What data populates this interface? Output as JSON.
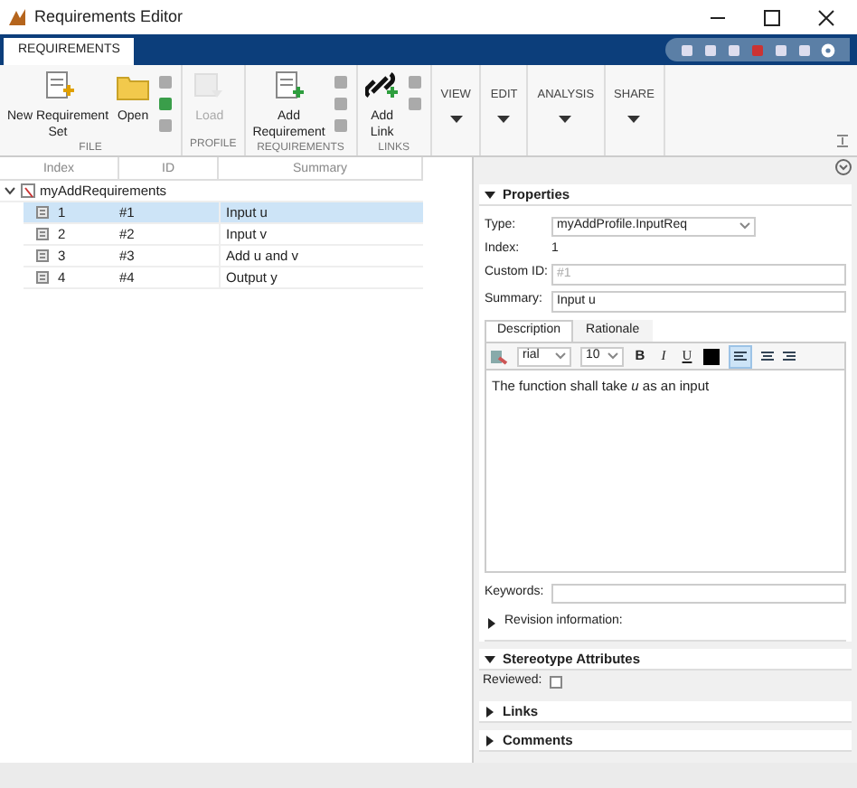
{
  "window": {
    "title": "Requirements Editor"
  },
  "ribbon": {
    "tabs": [
      {
        "label": "REQUIREMENTS",
        "selected": true
      }
    ],
    "groups": [
      {
        "label": "FILE",
        "buttons": [
          {
            "label": "New Requirement Set",
            "disabled": false
          },
          {
            "label": "Open",
            "disabled": false
          }
        ]
      },
      {
        "label": "PROFILE",
        "buttons": [
          {
            "label": "Load",
            "disabled": true
          }
        ]
      },
      {
        "label": "REQUIREMENTS",
        "buttons": [
          {
            "label": "Add Requirement",
            "disabled": false
          }
        ]
      },
      {
        "label": "LINKS",
        "buttons": [
          {
            "label": "Add Link",
            "disabled": false
          }
        ]
      }
    ],
    "menus": [
      "VIEW",
      "EDIT",
      "ANALYSIS",
      "SHARE"
    ]
  },
  "table": {
    "columns": [
      "Index",
      "ID",
      "Summary"
    ],
    "root": {
      "label": "myAddRequirements",
      "expanded": true,
      "children": [
        {
          "index": "1",
          "id": "#1",
          "summary": "Input u",
          "selected": true
        },
        {
          "index": "2",
          "id": "#2",
          "summary": "Input v",
          "selected": false
        },
        {
          "index": "3",
          "id": "#3",
          "summary": "Add u and v",
          "selected": false
        },
        {
          "index": "4",
          "id": "#4",
          "summary": "Output y",
          "selected": false
        }
      ]
    }
  },
  "properties": {
    "title": "Properties",
    "expanded": true,
    "type": {
      "label": "Type:",
      "value": "myAddProfile.InputReq"
    },
    "index": {
      "label": "Index:",
      "value": "1"
    },
    "custom_id": {
      "label": "Custom ID:",
      "placeholder": "#1"
    },
    "summary": {
      "label": "Summary:",
      "value": "Input u"
    },
    "tabs": [
      {
        "label": "Description",
        "selected": true
      },
      {
        "label": "Rationale",
        "selected": false
      }
    ],
    "font": "rial",
    "size": "10",
    "format": [
      "B",
      "I",
      "U"
    ],
    "description": "The function shall take *u* as an input",
    "keywords": {
      "label": "Keywords:"
    },
    "revision": {
      "label": "Revision information:",
      "expanded": false
    }
  },
  "sections": [
    {
      "title": "Stereotype Attributes",
      "expanded": true,
      "fields": [
        {
          "label": "Reviewed:",
          "checked": false
        }
      ]
    },
    {
      "title": "Links",
      "expanded": false
    },
    {
      "title": "Comments",
      "expanded": false
    }
  ]
}
